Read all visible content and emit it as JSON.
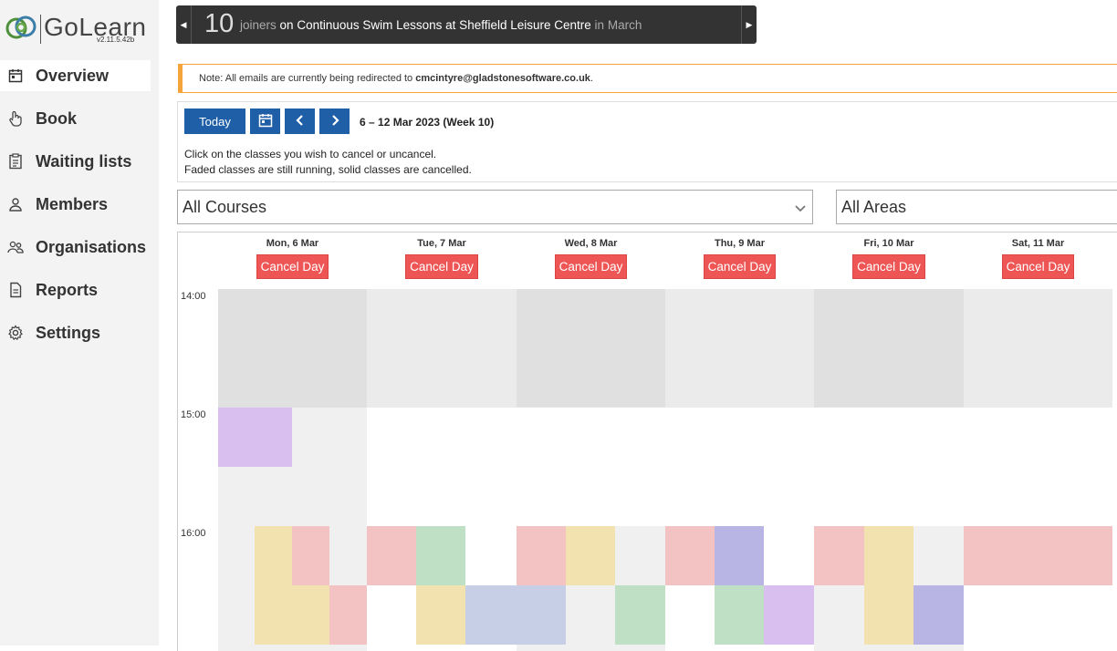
{
  "app": {
    "name": "GoLearn",
    "version": "v2.11.5.42b"
  },
  "sidebar": {
    "items": [
      {
        "label": "Overview",
        "icon": "calendar-icon",
        "active": true
      },
      {
        "label": "Book",
        "icon": "hand-pointer-icon"
      },
      {
        "label": "Waiting lists",
        "icon": "clipboard-list-icon"
      },
      {
        "label": "Members",
        "icon": "user-icon"
      },
      {
        "label": "Organisations",
        "icon": "users-icon"
      },
      {
        "label": "Reports",
        "icon": "document-icon"
      },
      {
        "label": "Settings",
        "icon": "gear-icon"
      }
    ]
  },
  "banner": {
    "count": "10",
    "word_joiners": "joiners",
    "word_on": "on",
    "course": "Continuous Swim Lessons at Sheffield Leisure Centre",
    "word_in": "in",
    "month": "March"
  },
  "note": {
    "prefix": "Note: All emails are currently being redirected to",
    "email": "cmcintyre@gladstonesoftware.co.uk",
    "suffix": "."
  },
  "toolbar": {
    "today": "Today",
    "week_label": "6 – 12 Mar 2023 (Week 10)"
  },
  "instructions": {
    "line1": "Click on the classes you wish to cancel or uncancel.",
    "line2": "Faded classes are still running, solid classes are cancelled."
  },
  "filters": {
    "courses": "All Courses",
    "areas": "All Areas"
  },
  "calendar": {
    "cancel_label": "Cancel Day",
    "hours": [
      "14:00",
      "15:00",
      "16:00"
    ],
    "days": [
      {
        "name": "Mon, 6 Mar"
      },
      {
        "name": "Tue, 7 Mar"
      },
      {
        "name": "Wed, 8 Mar"
      },
      {
        "name": "Thu, 9 Mar"
      },
      {
        "name": "Fri, 10 Mar"
      },
      {
        "name": "Sat, 11 Mar"
      }
    ]
  },
  "colors": {
    "purple": "#d9bff0",
    "salmon": "#f3c3c4",
    "green": "#bfe0c4",
    "yellow": "#f2e2b0",
    "blue": "#c6cfe6",
    "lavender": "#b8b4e4",
    "accent": "#1e5fa8",
    "cancel": "#ee5555",
    "warning": "#f4a43a"
  }
}
